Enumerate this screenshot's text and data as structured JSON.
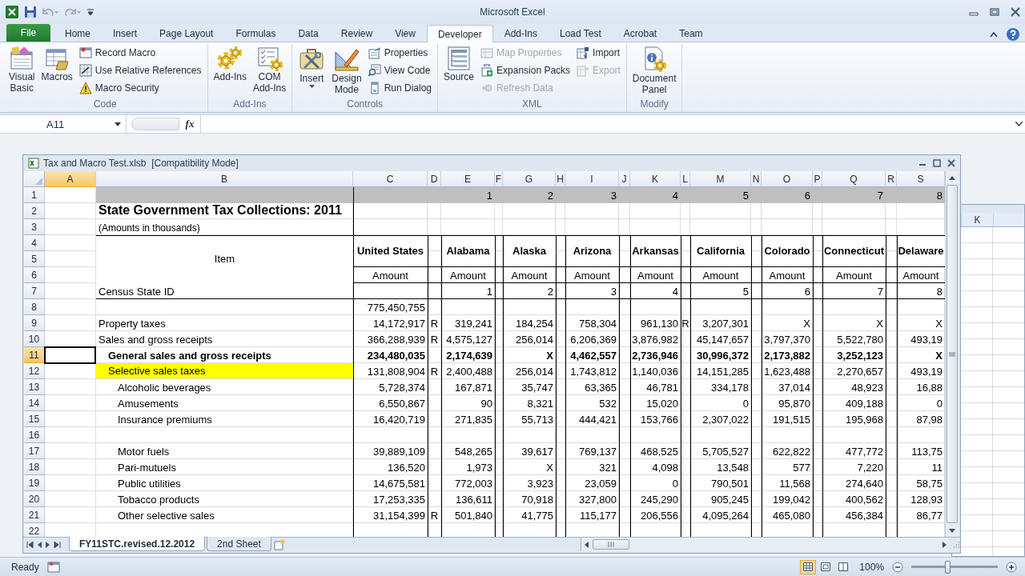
{
  "title_bar": {
    "title": "Microsoft Excel"
  },
  "ribbon_tabs": [
    {
      "label": "File",
      "kind": "file",
      "selected": false
    },
    {
      "label": "Home",
      "kind": "tab",
      "selected": false
    },
    {
      "label": "Insert",
      "kind": "tab",
      "selected": false
    },
    {
      "label": "Page Layout",
      "kind": "tab",
      "selected": false
    },
    {
      "label": "Formulas",
      "kind": "tab",
      "selected": false
    },
    {
      "label": "Data",
      "kind": "tab",
      "selected": false
    },
    {
      "label": "Review",
      "kind": "tab",
      "selected": false
    },
    {
      "label": "View",
      "kind": "tab",
      "selected": false
    },
    {
      "label": "Developer",
      "kind": "tab",
      "selected": true
    },
    {
      "label": "Add-Ins",
      "kind": "tab",
      "selected": false
    },
    {
      "label": "Load Test",
      "kind": "tab",
      "selected": false
    },
    {
      "label": "Acrobat",
      "kind": "tab",
      "selected": false
    },
    {
      "label": "Team",
      "kind": "tab",
      "selected": false
    }
  ],
  "ribbon_groups": [
    {
      "label": "Code",
      "items": [
        {
          "label": "Visual Basic",
          "kind": "large",
          "disabled": false
        },
        {
          "label": "Macros",
          "kind": "large",
          "disabled": false
        },
        {
          "label": "Record Macro",
          "kind": "small",
          "disabled": false
        },
        {
          "label": "Use Relative References",
          "kind": "small",
          "disabled": false
        },
        {
          "label": "Macro Security",
          "kind": "small",
          "disabled": false
        }
      ]
    },
    {
      "label": "Add-Ins",
      "items": [
        {
          "label": "Add-Ins",
          "kind": "large",
          "disabled": false
        },
        {
          "label": "COM Add-Ins",
          "kind": "large",
          "disabled": false
        }
      ]
    },
    {
      "label": "Controls",
      "items": [
        {
          "label": "Insert",
          "kind": "large",
          "disabled": false,
          "dropdown": true
        },
        {
          "label": "Design Mode",
          "kind": "large",
          "disabled": false
        },
        {
          "label": "Properties",
          "kind": "small",
          "disabled": false
        },
        {
          "label": "View Code",
          "kind": "small",
          "disabled": false
        },
        {
          "label": "Run Dialog",
          "kind": "small",
          "disabled": false
        }
      ]
    },
    {
      "label": "XML",
      "items": [
        {
          "label": "Source",
          "kind": "large",
          "disabled": false
        },
        {
          "label": "Map Properties",
          "kind": "small",
          "disabled": true
        },
        {
          "label": "Expansion Packs",
          "kind": "small",
          "disabled": false
        },
        {
          "label": "Refresh Data",
          "kind": "small",
          "disabled": true
        },
        {
          "label": "Import",
          "kind": "small",
          "disabled": false
        },
        {
          "label": "Export",
          "kind": "small",
          "disabled": true
        }
      ]
    },
    {
      "label": "Modify",
      "items": [
        {
          "label": "Document Panel",
          "kind": "large",
          "disabled": false
        }
      ]
    }
  ],
  "formula_bar": {
    "name_box": "A11",
    "function_label": "fx"
  },
  "workbook": {
    "title": "Tax and Macro Test.xlsb  [Compatibility Mode]",
    "columns": [
      {
        "letter": "A",
        "selected": true
      },
      {
        "letter": "B",
        "selected": false
      },
      {
        "letter": "C",
        "selected": false
      },
      {
        "letter": "D",
        "selected": false
      },
      {
        "letter": "E",
        "selected": false
      },
      {
        "letter": "F",
        "selected": false
      },
      {
        "letter": "G",
        "selected": false
      },
      {
        "letter": "H",
        "selected": false
      },
      {
        "letter": "I",
        "selected": false
      },
      {
        "letter": "J",
        "selected": false
      },
      {
        "letter": "K",
        "selected": false
      },
      {
        "letter": "L",
        "selected": false
      },
      {
        "letter": "M",
        "selected": false
      },
      {
        "letter": "N",
        "selected": false
      },
      {
        "letter": "O",
        "selected": false
      },
      {
        "letter": "P",
        "selected": false
      },
      {
        "letter": "Q",
        "selected": false
      },
      {
        "letter": "R",
        "selected": false
      },
      {
        "letter": "S",
        "selected": false
      }
    ],
    "rows": [
      {
        "number": "1",
        "selected": false,
        "kind": "band",
        "states": [
          {
            "value": "1"
          },
          {
            "value": "2"
          },
          {
            "value": "3"
          },
          {
            "value": "4"
          },
          {
            "value": "5"
          },
          {
            "value": "6"
          },
          {
            "value": "7"
          },
          {
            "value": "8"
          }
        ]
      },
      {
        "number": "2",
        "selected": false,
        "kind": "title",
        "label": "State Government Tax Collections: 2011"
      },
      {
        "number": "3",
        "selected": false,
        "kind": "note",
        "label": "(Amounts in thousands)"
      },
      {
        "number": "4",
        "selected": false,
        "kind": "header",
        "label": "Item",
        "total": "United States",
        "states": [
          {
            "value": "Alabama"
          },
          {
            "value": "Alaska"
          },
          {
            "value": "Arizona"
          },
          {
            "value": "Arkansas"
          },
          {
            "value": "California"
          },
          {
            "value": "Colorado"
          },
          {
            "value": "Connecticut"
          },
          {
            "value": "Delaware"
          }
        ]
      },
      {
        "number": "5",
        "selected": false,
        "kind": "blank"
      },
      {
        "number": "6",
        "selected": false,
        "kind": "units",
        "total": "Amount",
        "states": [
          {
            "value": "Amount"
          },
          {
            "value": "Amount"
          },
          {
            "value": "Amount"
          },
          {
            "value": "Amount"
          },
          {
            "value": "Amount"
          },
          {
            "value": "Amount"
          },
          {
            "value": "Amount"
          },
          {
            "value": "Amount"
          }
        ]
      },
      {
        "number": "7",
        "selected": false,
        "kind": "id",
        "label": "Census State ID",
        "states": [
          {
            "value": "1"
          },
          {
            "value": "2"
          },
          {
            "value": "3"
          },
          {
            "value": "4"
          },
          {
            "value": "5"
          },
          {
            "value": "6"
          },
          {
            "value": "7"
          },
          {
            "value": "8"
          }
        ]
      },
      {
        "number": "8",
        "selected": false,
        "kind": "data",
        "total": "775,450,755"
      },
      {
        "number": "9",
        "selected": false,
        "kind": "data",
        "label": "Property taxes",
        "total": "14,172,917",
        "total_flag": "R",
        "states": [
          {
            "value": "319,241"
          },
          {
            "value": "184,254"
          },
          {
            "value": "758,304"
          },
          {
            "value": "961,130",
            "flag": "R"
          },
          {
            "value": "3,207,301"
          },
          {
            "value": "X"
          },
          {
            "value": "X"
          },
          {
            "value": "X"
          }
        ]
      },
      {
        "number": "10",
        "selected": false,
        "kind": "data",
        "label": "Sales and gross receipts",
        "total": "366,288,939",
        "total_flag": "R",
        "states": [
          {
            "value": "4,575,127"
          },
          {
            "value": "256,014"
          },
          {
            "value": "6,206,369"
          },
          {
            "value": "3,876,982"
          },
          {
            "value": "45,147,657"
          },
          {
            "value": "3,797,370"
          },
          {
            "value": "5,522,780"
          },
          {
            "value": "493,19"
          }
        ],
        "children": [
          {
            "number": "11",
            "selected": true,
            "kind": "data",
            "bold": true,
            "label": "General sales and gross receipts",
            "total": "234,480,035",
            "states": [
              {
                "value": "2,174,639"
              },
              {
                "value": "X"
              },
              {
                "value": "4,462,557"
              },
              {
                "value": "2,736,946"
              },
              {
                "value": "30,996,372"
              },
              {
                "value": "2,173,882"
              },
              {
                "value": "3,252,123"
              },
              {
                "value": "X"
              }
            ]
          },
          {
            "number": "12",
            "selected": false,
            "kind": "data",
            "highlighted": true,
            "label": "Selective sales taxes",
            "total": "131,808,904",
            "total_flag": "R",
            "states": [
              {
                "value": "2,400,488"
              },
              {
                "value": "256,014"
              },
              {
                "value": "1,743,812"
              },
              {
                "value": "1,140,036"
              },
              {
                "value": "14,151,285"
              },
              {
                "value": "1,623,488"
              },
              {
                "value": "2,270,657"
              },
              {
                "value": "493,19"
              }
            ],
            "children": [
              {
                "number": "13",
                "selected": false,
                "kind": "data",
                "label": "Alcoholic beverages",
                "total": "5,728,374",
                "states": [
                  {
                    "value": "167,871"
                  },
                  {
                    "value": "35,747"
                  },
                  {
                    "value": "63,365"
                  },
                  {
                    "value": "46,781"
                  },
                  {
                    "value": "334,178"
                  },
                  {
                    "value": "37,014"
                  },
                  {
                    "value": "48,923"
                  },
                  {
                    "value": "16,88"
                  }
                ]
              },
              {
                "number": "14",
                "selected": false,
                "kind": "data",
                "label": "Amusements",
                "total": "6,550,867",
                "states": [
                  {
                    "value": "90"
                  },
                  {
                    "value": "8,321"
                  },
                  {
                    "value": "532"
                  },
                  {
                    "value": "15,020"
                  },
                  {
                    "value": "0"
                  },
                  {
                    "value": "95,870"
                  },
                  {
                    "value": "409,188"
                  },
                  {
                    "value": "0"
                  }
                ]
              },
              {
                "number": "15",
                "selected": false,
                "kind": "data",
                "label": "Insurance premiums",
                "total": "16,420,719",
                "states": [
                  {
                    "value": "271,835"
                  },
                  {
                    "value": "55,713"
                  },
                  {
                    "value": "444,421"
                  },
                  {
                    "value": "153,766"
                  },
                  {
                    "value": "2,307,022"
                  },
                  {
                    "value": "191,515"
                  },
                  {
                    "value": "195,968"
                  },
                  {
                    "value": "87,98"
                  }
                ]
              },
              {
                "number": "16",
                "selected": false,
                "kind": "data"
              },
              {
                "number": "17",
                "selected": false,
                "kind": "data",
                "label": "Motor fuels",
                "total": "39,889,109",
                "states": [
                  {
                    "value": "548,265"
                  },
                  {
                    "value": "39,617"
                  },
                  {
                    "value": "769,137"
                  },
                  {
                    "value": "468,525"
                  },
                  {
                    "value": "5,705,527"
                  },
                  {
                    "value": "622,822"
                  },
                  {
                    "value": "477,772"
                  },
                  {
                    "value": "113,75"
                  }
                ]
              },
              {
                "number": "18",
                "selected": false,
                "kind": "data",
                "label": "Pari-mutuels",
                "total": "136,520",
                "states": [
                  {
                    "value": "1,973"
                  },
                  {
                    "value": "X"
                  },
                  {
                    "value": "321"
                  },
                  {
                    "value": "4,098"
                  },
                  {
                    "value": "13,548"
                  },
                  {
                    "value": "577"
                  },
                  {
                    "value": "7,220"
                  },
                  {
                    "value": "11"
                  }
                ]
              },
              {
                "number": "19",
                "selected": false,
                "kind": "data",
                "label": "Public utilities",
                "total": "14,675,581",
                "states": [
                  {
                    "value": "772,003"
                  },
                  {
                    "value": "3,923"
                  },
                  {
                    "value": "23,059"
                  },
                  {
                    "value": "0"
                  },
                  {
                    "value": "790,501"
                  },
                  {
                    "value": "11,568"
                  },
                  {
                    "value": "274,640"
                  },
                  {
                    "value": "58,75"
                  }
                ]
              },
              {
                "number": "20",
                "selected": false,
                "kind": "data",
                "label": "Tobacco products",
                "total": "17,253,335",
                "states": [
                  {
                    "value": "136,611"
                  },
                  {
                    "value": "70,918"
                  },
                  {
                    "value": "327,800"
                  },
                  {
                    "value": "245,290"
                  },
                  {
                    "value": "905,245"
                  },
                  {
                    "value": "199,042"
                  },
                  {
                    "value": "400,562"
                  },
                  {
                    "value": "128,93"
                  }
                ]
              },
              {
                "number": "21",
                "selected": false,
                "kind": "data",
                "label": "Other selective sales",
                "total": "31,154,399",
                "total_flag": "R",
                "states": [
                  {
                    "value": "501,840"
                  },
                  {
                    "value": "41,775"
                  },
                  {
                    "value": "115,177"
                  },
                  {
                    "value": "206,556"
                  },
                  {
                    "value": "4,095,264"
                  },
                  {
                    "value": "465,080"
                  },
                  {
                    "value": "456,384"
                  },
                  {
                    "value": "86,77"
                  }
                ]
              }
            ]
          }
        ]
      },
      {
        "number": "22",
        "selected": false,
        "kind": "data"
      }
    ],
    "sheet_tabs": [
      {
        "label": "FY11STC.revised.12.2012",
        "selected": true
      },
      {
        "label": "2nd Sheet",
        "selected": false
      }
    ]
  },
  "background_window": {
    "column": "K"
  },
  "status_bar": {
    "mode": "Ready",
    "views": [
      {
        "selected": true
      },
      {
        "selected": false
      },
      {
        "selected": false
      }
    ],
    "zoom": "100%",
    "zoom_slider": {
      "level": 0.42
    }
  }
}
